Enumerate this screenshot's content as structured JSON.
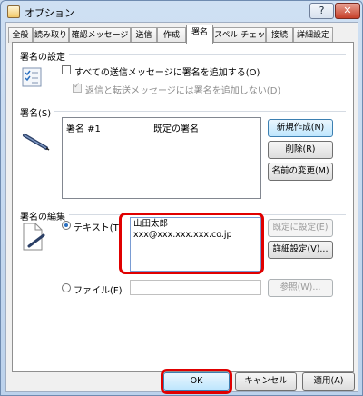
{
  "window": {
    "title": "オプション",
    "help_label": "?",
    "close_label": "✕"
  },
  "tabs": [
    {
      "label": "全般"
    },
    {
      "label": "読み取り"
    },
    {
      "label": "確認メッセージ"
    },
    {
      "label": "送信"
    },
    {
      "label": "作成"
    },
    {
      "label": "署名"
    },
    {
      "label": "スペル チェック"
    },
    {
      "label": "接続"
    },
    {
      "label": "詳細設定"
    }
  ],
  "active_tab": "署名",
  "settings": {
    "heading": "署名の設定",
    "add_all_label": "すべての送信メッセージに署名を追加する(O)",
    "no_reply_label": "返信と転送メッセージには署名を追加しない(D)"
  },
  "signatures": {
    "heading": "署名(S)",
    "row": {
      "name": "署名 #1",
      "default": "既定の署名"
    },
    "new_button": "新規作成(N)",
    "delete_button": "削除(R)",
    "rename_button": "名前の変更(M)"
  },
  "edit": {
    "heading": "署名の編集",
    "text_label": "テキスト(T)",
    "text_line1": "山田太郎",
    "text_line2": "xxx@xxx.xxx.xxx.co.jp",
    "set_default_button": "既定に設定(E)",
    "advanced_button": "詳細設定(V)...",
    "file_label": "ファイル(F)",
    "file_value": "",
    "browse_button": "参照(W)..."
  },
  "footer": {
    "ok_button": "OK",
    "cancel_button": "キャンセル",
    "apply_button": "適用(A)"
  },
  "colors": {
    "highlight": "#e00000",
    "accent": "#3c7fb1"
  }
}
